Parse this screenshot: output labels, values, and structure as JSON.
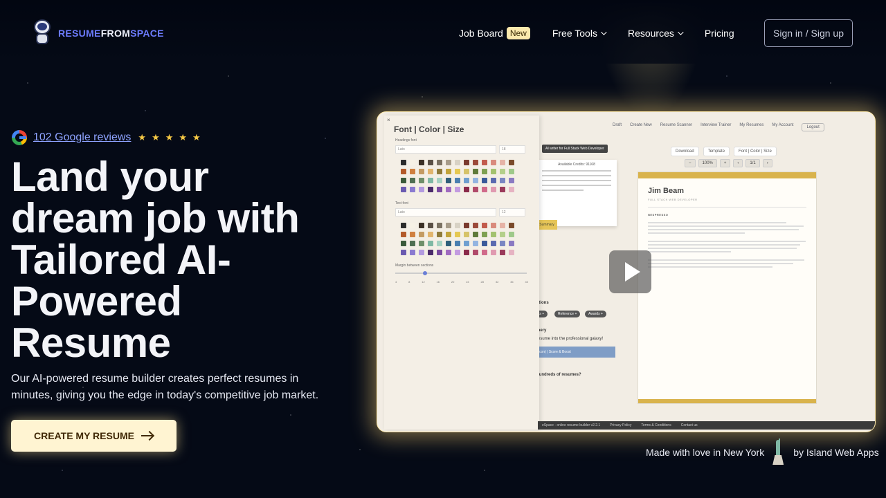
{
  "brand": {
    "part1": "RESUME",
    "part2": "FROM",
    "part3": "SPACE"
  },
  "nav": {
    "job_board": "Job Board",
    "job_board_badge": "New",
    "free_tools": "Free Tools",
    "resources": "Resources",
    "pricing": "Pricing",
    "signin": "Sign in / Sign up"
  },
  "hero": {
    "reviews_link": "102 Google reviews",
    "rating_stars": 5,
    "title": "Land your dream job with Tailored AI-Powered Resume",
    "subtitle": "Our AI-powered resume builder creates perfect resumes in minutes, giving you the edge in today's competitive job market.",
    "cta_label": "CREATE MY RESUME"
  },
  "preview": {
    "app_nav": [
      "Draft",
      "Create New",
      "Resume Scanner",
      "Interview Trainer",
      "My Resumes",
      "My Account",
      "Logout"
    ],
    "toolbar": [
      "Download",
      "Template",
      "Font | Color | Size"
    ],
    "zoom": [
      "100%",
      "1/1"
    ],
    "panel_title": "Font | Color | Size",
    "headings_font_label": "Headings font",
    "headings_font_value": "Lato",
    "headings_size_value": "18",
    "text_font_label": "Text font",
    "text_font_value": "Lato",
    "text_size_value": "12",
    "margin_label": "Margin between sections",
    "margin_ticks": [
      "4",
      "8",
      "12",
      "16",
      "20",
      "24",
      "28",
      "32",
      "36",
      "40"
    ],
    "ai_writer": "AI writer for Full Stack Web Developer",
    "available_credits": "Available Credits: 91168",
    "summary_btn": "Summary",
    "sections_label": "ctions",
    "chips": [
      "ts +",
      "Reference +",
      "Awards +"
    ],
    "finery_label": "inery",
    "galaxy_text": "resume into the professional galaxy!",
    "score_bar": "con) | Score & Boost",
    "hundreds_text": "hundreds of resumes?",
    "resume_name": "Jim Beam",
    "resume_role": "FULL STACK WEB DEVELOPER",
    "resume_company": "NESPRESSO",
    "footer_links": [
      "eSpace - online resume builder v2.2.1",
      "Privacy Policy",
      "Terms & Conditions",
      "Contact us"
    ]
  },
  "footer": {
    "made_with": "Made with love in New York",
    "by": "by Island Web Apps"
  },
  "colors": {
    "accent_logo": "#6d7cff",
    "badge_new": "#fbe9ad",
    "cta_bg": "#fff4d2",
    "glow": "#fbe6a7"
  },
  "icons": [
    "astronaut-icon",
    "google-icon",
    "star-icon",
    "chevron-down-icon",
    "arrow-right-icon",
    "play-icon",
    "statue-of-liberty-icon"
  ]
}
